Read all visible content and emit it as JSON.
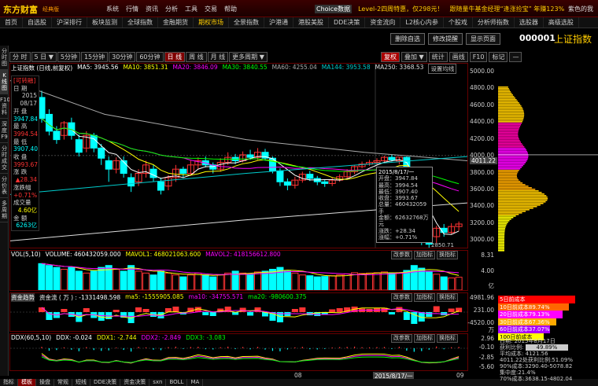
{
  "app": {
    "logo": "东方财富",
    "edition": "经典版"
  },
  "menu": [
    "系统",
    "行情",
    "资讯",
    "分析",
    "工具",
    "交易",
    "帮助"
  ],
  "promo": {
    "tag": "Choice数据",
    "level2": "Level-2四周特惠，仅298元！",
    "fund": "跟随量牛基金经理“逢涨捡宝” 年赚123%"
  },
  "skin": "紫色的我",
  "tabs": [
    {
      "label": "首页",
      "active": false
    },
    {
      "label": "自选股",
      "active": false
    },
    {
      "label": "沪深排行",
      "active": false
    },
    {
      "label": "板块监测",
      "active": false
    },
    {
      "label": "全球指数",
      "active": false
    },
    {
      "label": "金融期货",
      "active": false
    },
    {
      "label": "期权市场",
      "active": true
    },
    {
      "label": "全景指数",
      "active": false
    },
    {
      "label": "沪港通",
      "active": false
    },
    {
      "label": "港股美股",
      "active": false
    },
    {
      "label": "DDE决策",
      "active": false
    },
    {
      "label": "资金流向",
      "active": false
    },
    {
      "label": "L2核心内参",
      "active": false
    },
    {
      "label": "个股戏",
      "active": false
    },
    {
      "label": "分析师指数",
      "active": false
    },
    {
      "label": "选股器",
      "active": false
    },
    {
      "label": "高级选股",
      "active": false
    }
  ],
  "left_tabs": [
    "分时图",
    "K线图",
    "F10资料",
    "深度F9",
    "分时成交",
    "分价表",
    "多周期"
  ],
  "top_buttons": [
    "删除自选",
    "修改提醒",
    "显示页面"
  ],
  "index": {
    "code": "000001",
    "name": "上证指数"
  },
  "periods": [
    {
      "label": "分 时",
      "active": false
    },
    {
      "label": "5 日 ▼",
      "active": false
    },
    {
      "label": "5分钟",
      "active": false
    },
    {
      "label": "15分钟",
      "active": false
    },
    {
      "label": "30分钟",
      "active": false
    },
    {
      "label": "60分钟",
      "active": false
    },
    {
      "label": "日 线",
      "active": true
    },
    {
      "label": "周 线",
      "active": false
    },
    {
      "label": "月 线",
      "active": false
    },
    {
      "label": "更多周期 ▼",
      "active": false
    }
  ],
  "right_buttons": [
    {
      "label": "复权",
      "red": true
    },
    {
      "label": "叠加 ▼",
      "red": false
    },
    {
      "label": "统计",
      "red": false
    },
    {
      "label": "画线",
      "red": false
    },
    {
      "label": "F10",
      "red": false
    },
    {
      "label": "标记",
      "red": false
    },
    {
      "label": "—",
      "red": false
    }
  ],
  "chart_header": {
    "name": "上证指数 (日线,前复权)",
    "items": [
      {
        "text": "MA5: 3945.56",
        "color": "#ffffff"
      },
      {
        "text": "MA10: 3851.31",
        "color": "#ffff00"
      },
      {
        "text": "MA20: 3846.09",
        "color": "#ff00ff"
      },
      {
        "text": "MA30: 3840.55",
        "color": "#00ff00"
      },
      {
        "text": "MA60: 4255.04",
        "color": "#aaaaaa"
      },
      {
        "text": "MA144: 3953.58",
        "color": "#00cccc"
      },
      {
        "text": "MA250: 3368.53",
        "color": "#dddddd"
      }
    ],
    "setting": "设置均线"
  },
  "info_panel": {
    "tag": "[可转融]",
    "date_label": "日 期",
    "date": "2015",
    "date2": "08/17",
    "open_label": "开 盘",
    "open": "3947.84",
    "high_label": "最 高",
    "high": "3994.54",
    "low_label": "最 低",
    "low": "3907.40",
    "close_label": "收 盘",
    "close": "3993.67",
    "chg_label": "涨 跌",
    "chg": "▲28.34",
    "pct_label": "涨跌幅",
    "pct": "+0.71%",
    "vol_label": "成交量",
    "vol": "4.60亿",
    "amt_label": "金 额",
    "amt": "6263亿"
  },
  "price_box": "4011.22",
  "ylabels": [
    "5000.00",
    "4800.00",
    "4600.00",
    "4400.00",
    "4200.00",
    "4000.00",
    "3800.00",
    "3600.00",
    "3400.00",
    "3200.00",
    "3000.00"
  ],
  "tooltip": {
    "date": "2015/8/17/一",
    "open": "开盘：3947.84",
    "high": "最高：3994.54",
    "low": "最低：3907.40",
    "close": "收盘：3993.67",
    "vol": "总量：460432059手",
    "amt": "金额：62632768万元",
    "chg": "涨跌：+28.34",
    "pct": "涨幅：+0.71%"
  },
  "low_mark": "2850.71",
  "vol_header": {
    "name": "VOL(5,10)",
    "items": [
      {
        "text": "VOLUME: 460432059.000",
        "color": "#ffffff"
      },
      {
        "text": "MAVOL1: 468021063.600",
        "color": "#ffff00"
      },
      {
        "text": "MAVOL2: 418156612.800",
        "color": "#ff00ff"
      }
    ]
  },
  "vol_ylabels": [
    "8.31",
    "4.00",
    "亿"
  ],
  "fund_header": {
    "name": "资金趋势",
    "items": [
      {
        "text": "资金流 ( 万 ) : -1331498.598",
        "color": "#ffffff"
      },
      {
        "text": "ma5: -1555905.085",
        "color": "#ffff00"
      },
      {
        "text": "ma10: -34755.571",
        "color": "#ff00ff"
      },
      {
        "text": "ma20: -980600.375",
        "color": "#00ff00"
      }
    ]
  },
  "fund_ylabels": [
    "4981.96",
    "231.00",
    "-4520.00",
    "万"
  ],
  "ddx_header": {
    "name": "DDX(60,5,10)",
    "items": [
      {
        "text": "DDX: -0.024",
        "color": "#ffffff"
      },
      {
        "text": "DDX1: -2.744",
        "color": "#ffff00"
      },
      {
        "text": "DDX2: -2.849",
        "color": "#ff00ff"
      },
      {
        "text": "DDX3: -3.083",
        "color": "#00ff00"
      }
    ]
  },
  "ddx_ylabels": [
    "2.96",
    "-0.10",
    "-2.85",
    "-5.60"
  ],
  "sub_buttons": [
    "改参数",
    "加指标",
    "换指标"
  ],
  "xaxis": {
    "m1": "08",
    "cursor": "2015/8/17/一",
    "m2": "09"
  },
  "bottom_tabs": [
    {
      "label": "指标",
      "active": false
    },
    {
      "label": "模板",
      "active": true
    },
    {
      "label": "操盘",
      "active": false
    },
    {
      "label": "常规",
      "active": false
    },
    {
      "label": "短线",
      "active": false
    },
    {
      "label": "DDE决策",
      "active": false
    },
    {
      "label": "资金决策",
      "active": false
    },
    {
      "label": "sxn",
      "active": false
    },
    {
      "label": "BOLL",
      "active": false
    },
    {
      "label": "MA",
      "active": false
    }
  ],
  "cyq_legend": [
    {
      "text": "5日前成本",
      "color": "#ff0000"
    },
    {
      "text": "10日前成本89.74%",
      "color": "#ff6600"
    },
    {
      "text": "20日前成本79.13%",
      "color": "#ff00ff"
    },
    {
      "text": "30日前成本67.36%",
      "color": "#ffaa00"
    },
    {
      "text": "60日前成本37.07%",
      "color": "#aa00ff"
    },
    {
      "text": "100日前成本12.21%",
      "color": "#ffff00"
    }
  ],
  "cyq_info": {
    "date": "日期: 2015年8月17日",
    "profit_label": "获利比例:",
    "profit": "49.89%",
    "avg": "平均成本: 4121.56",
    "profit_at": "4011.22处获利比例:51.09%",
    "c90": "90%成本:3290.40-5078.82",
    "conc90": "集中度:21.4%",
    "c70": "70%成本:3638.15-4802.04"
  }
}
